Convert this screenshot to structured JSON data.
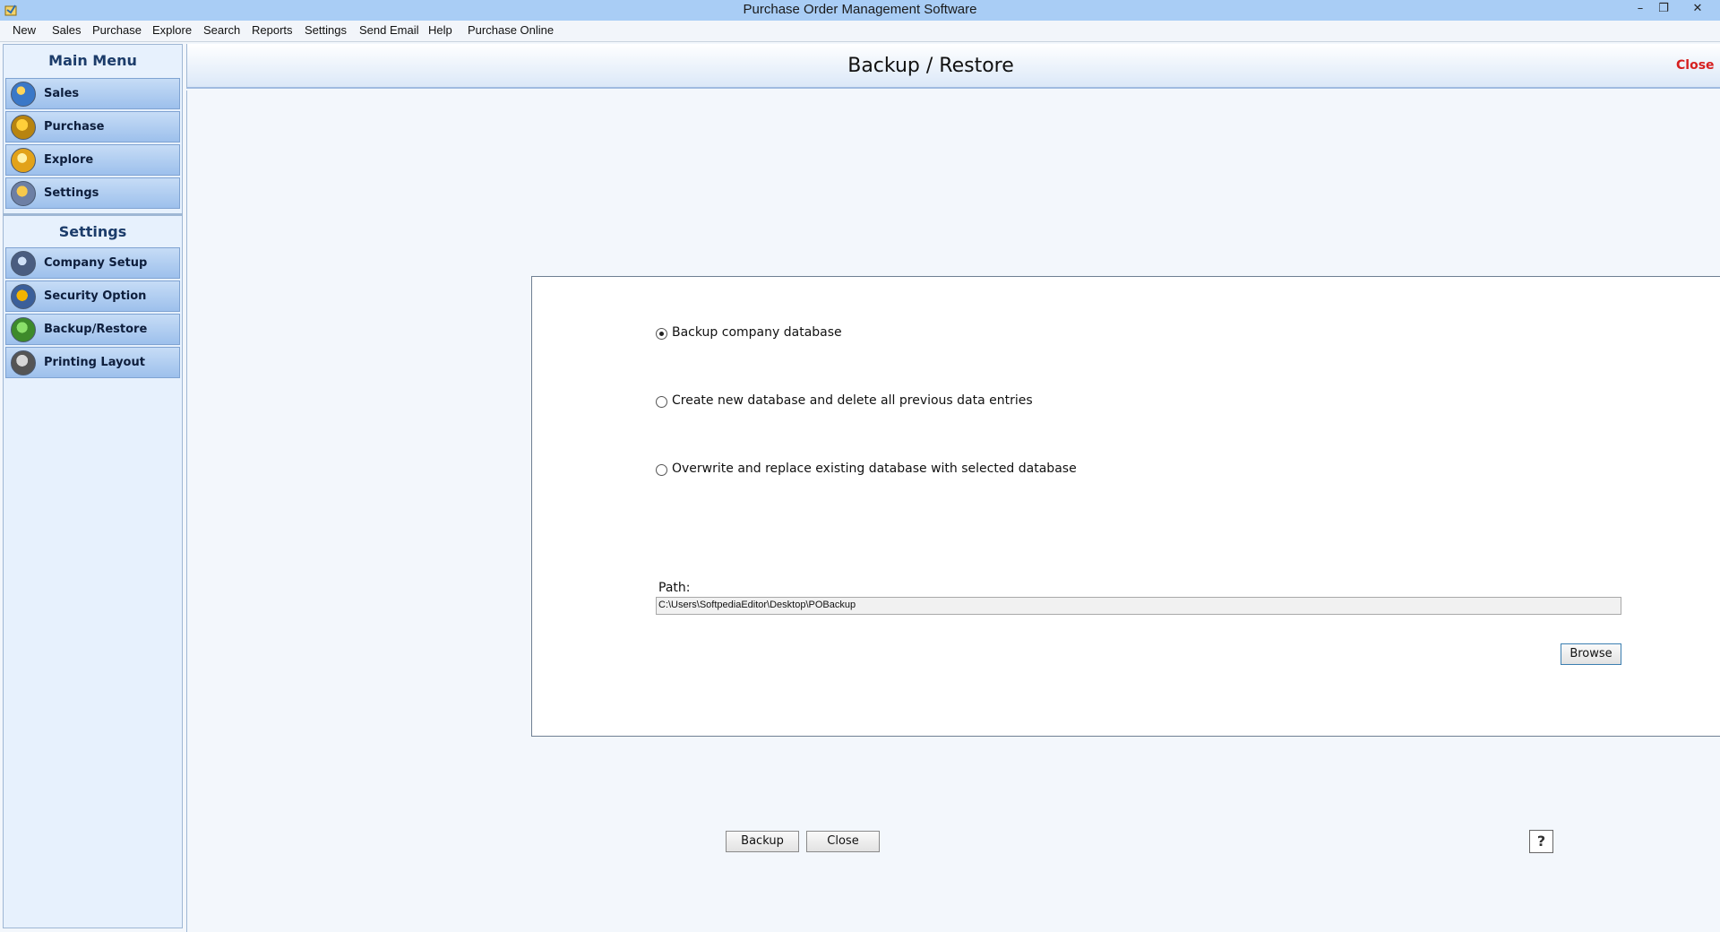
{
  "window": {
    "title": "Purchase Order Management Software",
    "minimize_glyph": "–",
    "maximize_glyph": "❐",
    "close_glyph": "✕"
  },
  "menubar": {
    "items": [
      "New",
      "Sales",
      "Purchase",
      "Explore",
      "Search",
      "Reports",
      "Settings",
      "Send Email",
      "Help",
      "Purchase Online"
    ]
  },
  "sidebar": {
    "main_menu_title": "Main Menu",
    "main_items": [
      {
        "label": "Sales",
        "icon": "sales-chart-icon"
      },
      {
        "label": "Purchase",
        "icon": "purchase-box-icon"
      },
      {
        "label": "Explore",
        "icon": "explore-folder-icon"
      },
      {
        "label": "Settings",
        "icon": "settings-gear-icon"
      }
    ],
    "settings_title": "Settings",
    "settings_items": [
      {
        "label": "Company Setup",
        "icon": "company-setup-icon"
      },
      {
        "label": "Security Option",
        "icon": "security-lock-icon"
      },
      {
        "label": "Backup/Restore",
        "icon": "backup-restore-icon"
      },
      {
        "label": "Printing Layout",
        "icon": "printer-icon"
      }
    ]
  },
  "main": {
    "title": "Backup / Restore",
    "header_close": "Close",
    "options": [
      {
        "label": "Backup company database",
        "selected": true
      },
      {
        "label": "Create new database and delete all previous data entries",
        "selected": false
      },
      {
        "label": "Overwrite and replace existing database with selected database",
        "selected": false
      }
    ],
    "path_label": "Path:",
    "path_value": "C:\\Users\\SoftpediaEditor\\Desktop\\POBackup",
    "browse_label": "Browse",
    "backup_label": "Backup",
    "close_label": "Close",
    "help_glyph": "?"
  }
}
